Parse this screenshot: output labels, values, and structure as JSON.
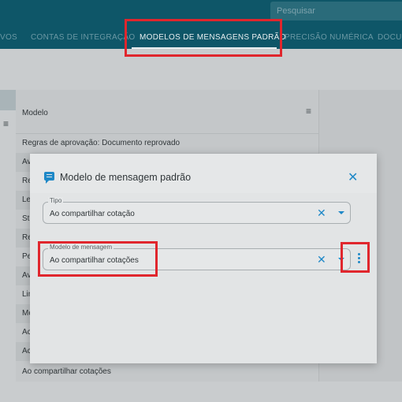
{
  "header": {
    "search_placeholder": "Pesquisar",
    "tabs": [
      {
        "label": "VOS"
      },
      {
        "label": "CONTAS DE INTEGRAÇÃO"
      },
      {
        "label": "MODELOS DE MENSAGENS PADRÃO"
      },
      {
        "label": "PRECISÃO NUMÉRICA"
      },
      {
        "label": "DOCU"
      }
    ]
  },
  "list": {
    "column_title": "Modelo",
    "menu_icon": "≡",
    "rows": [
      {
        "label": "Regras de aprovação: Documento reprovado"
      },
      {
        "label": "Av"
      },
      {
        "label": "Re"
      },
      {
        "label": "Le"
      },
      {
        "label": "St"
      },
      {
        "label": "Re"
      },
      {
        "label": "Pe"
      },
      {
        "label": "Av"
      },
      {
        "label": "Lin"
      },
      {
        "label": "Me"
      },
      {
        "label": "Ac"
      },
      {
        "label": "Ac"
      },
      {
        "label": "Ao compartilhar cotações"
      }
    ]
  },
  "left_menu_icon": "≡",
  "modal": {
    "title": "Modelo de mensagem padrão",
    "close_icon": "✕",
    "tipo": {
      "label": "Tipo",
      "value": "Ao compartilhar cotação",
      "clear_icon": "✕"
    },
    "modelo": {
      "label": "Modelo de mensagem",
      "value": "Ao compartilhar cotações",
      "clear_icon": "✕"
    }
  }
}
